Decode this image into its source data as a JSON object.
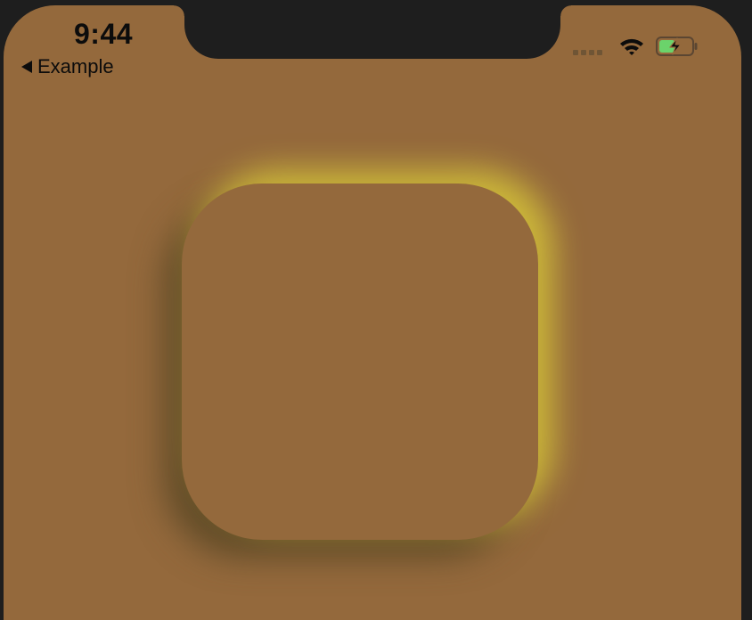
{
  "status_bar": {
    "time": "9:44",
    "signal_icon": "cellular-signal-icon",
    "wifi_icon": "wifi-icon",
    "battery_icon": "battery-charging-icon",
    "battery_level": 0.5
  },
  "navigation": {
    "back_label": "Example",
    "back_icon": "back-triangle-icon"
  },
  "colors": {
    "background": "#94693c",
    "highlight_shadow": "#d6c43a",
    "dark_shadow": "#584626",
    "battery_fill": "#6bd36b"
  }
}
